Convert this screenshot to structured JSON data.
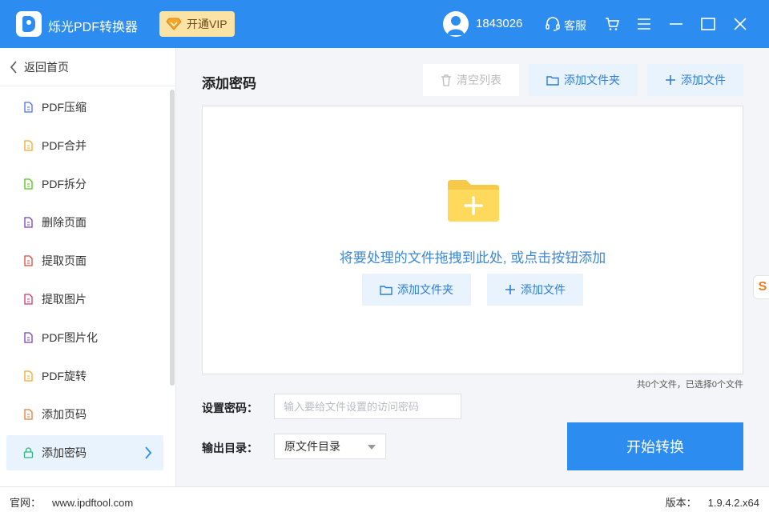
{
  "app": {
    "title": "烁光PDF转换器",
    "vip_label": "开通VIP",
    "user_id": "1843026",
    "service_label": "客服"
  },
  "colors": {
    "accent": "#2d8cf0",
    "accent_light": "#e8f3fe",
    "vip_bg": "#fbe3a5"
  },
  "sidebar": {
    "back_label": "返回首页",
    "items": [
      {
        "label": "PDF压缩",
        "icon": "compress-icon",
        "color": "#4a6cf7"
      },
      {
        "label": "PDF合并",
        "icon": "merge-icon",
        "color": "#f5a623"
      },
      {
        "label": "PDF拆分",
        "icon": "split-icon",
        "color": "#52c41a"
      },
      {
        "label": "删除页面",
        "icon": "delete-page-icon",
        "color": "#7b3fb8"
      },
      {
        "label": "提取页面",
        "icon": "extract-page-icon",
        "color": "#e0443c"
      },
      {
        "label": "提取图片",
        "icon": "extract-image-icon",
        "color": "#d6336c"
      },
      {
        "label": "PDF图片化",
        "icon": "pdf-to-image-icon",
        "color": "#7b3fb8"
      },
      {
        "label": "PDF旋转",
        "icon": "rotate-icon",
        "color": "#f5a623"
      },
      {
        "label": "添加页码",
        "icon": "page-number-icon",
        "color": "#e57c3a"
      },
      {
        "label": "添加密码",
        "icon": "lock-icon",
        "color": "#2fb57d",
        "active": true
      }
    ]
  },
  "main": {
    "title": "添加密码",
    "toolbar": {
      "clear_label": "清空列表",
      "add_folder_label": "添加文件夹",
      "add_file_label": "添加文件"
    },
    "dropzone": {
      "hint": "将要处理的文件拖拽到此处, 或点击按钮添加",
      "add_folder_label": "添加文件夹",
      "add_file_label": "添加文件"
    },
    "file_count": "共0个文件，已选择0个文件",
    "password": {
      "label": "设置密码：",
      "placeholder": "输入要给文件设置的访问密码",
      "value": ""
    },
    "output": {
      "label": "输出目录：",
      "selected": "原文件目录"
    },
    "start_label": "开始转换"
  },
  "footer": {
    "site_label": "官网：",
    "site_url": "www.ipdftool.com",
    "version_label": "版本：",
    "version": "1.9.4.2.x64"
  }
}
